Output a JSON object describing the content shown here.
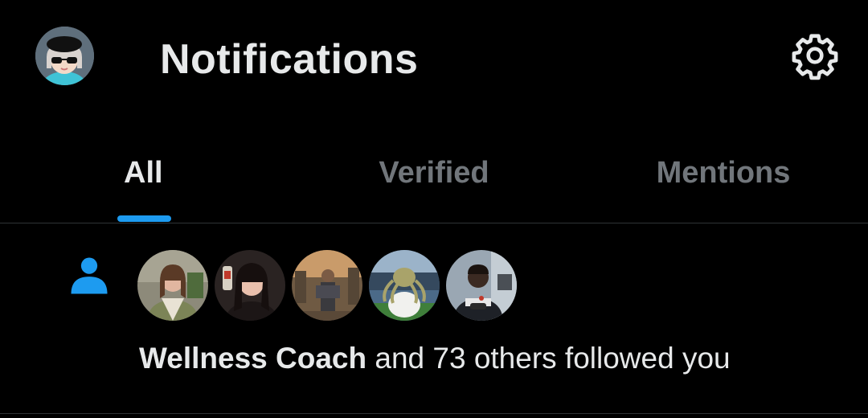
{
  "header": {
    "title": "Notifications",
    "avatar_icon": "profile-avatar-cap-sunglasses",
    "settings_icon": "gear-icon"
  },
  "tabs": [
    {
      "label": "All",
      "active": true
    },
    {
      "label": "Verified",
      "active": false
    },
    {
      "label": "Mentions",
      "active": false
    }
  ],
  "colors": {
    "background": "#000000",
    "text_primary": "#e7e9ea",
    "text_secondary": "#71767b",
    "accent": "#1d9bf0",
    "divider": "#2f3336"
  },
  "notification": {
    "type_icon": "person-icon",
    "follower_avatars": [
      "avatar-woman-blazer",
      "avatar-woman-selfie",
      "avatar-armored-warrior",
      "avatar-octopus-stadium",
      "avatar-man-controller"
    ],
    "name": "Wellness Coach",
    "message": " and 73 others followed you"
  }
}
